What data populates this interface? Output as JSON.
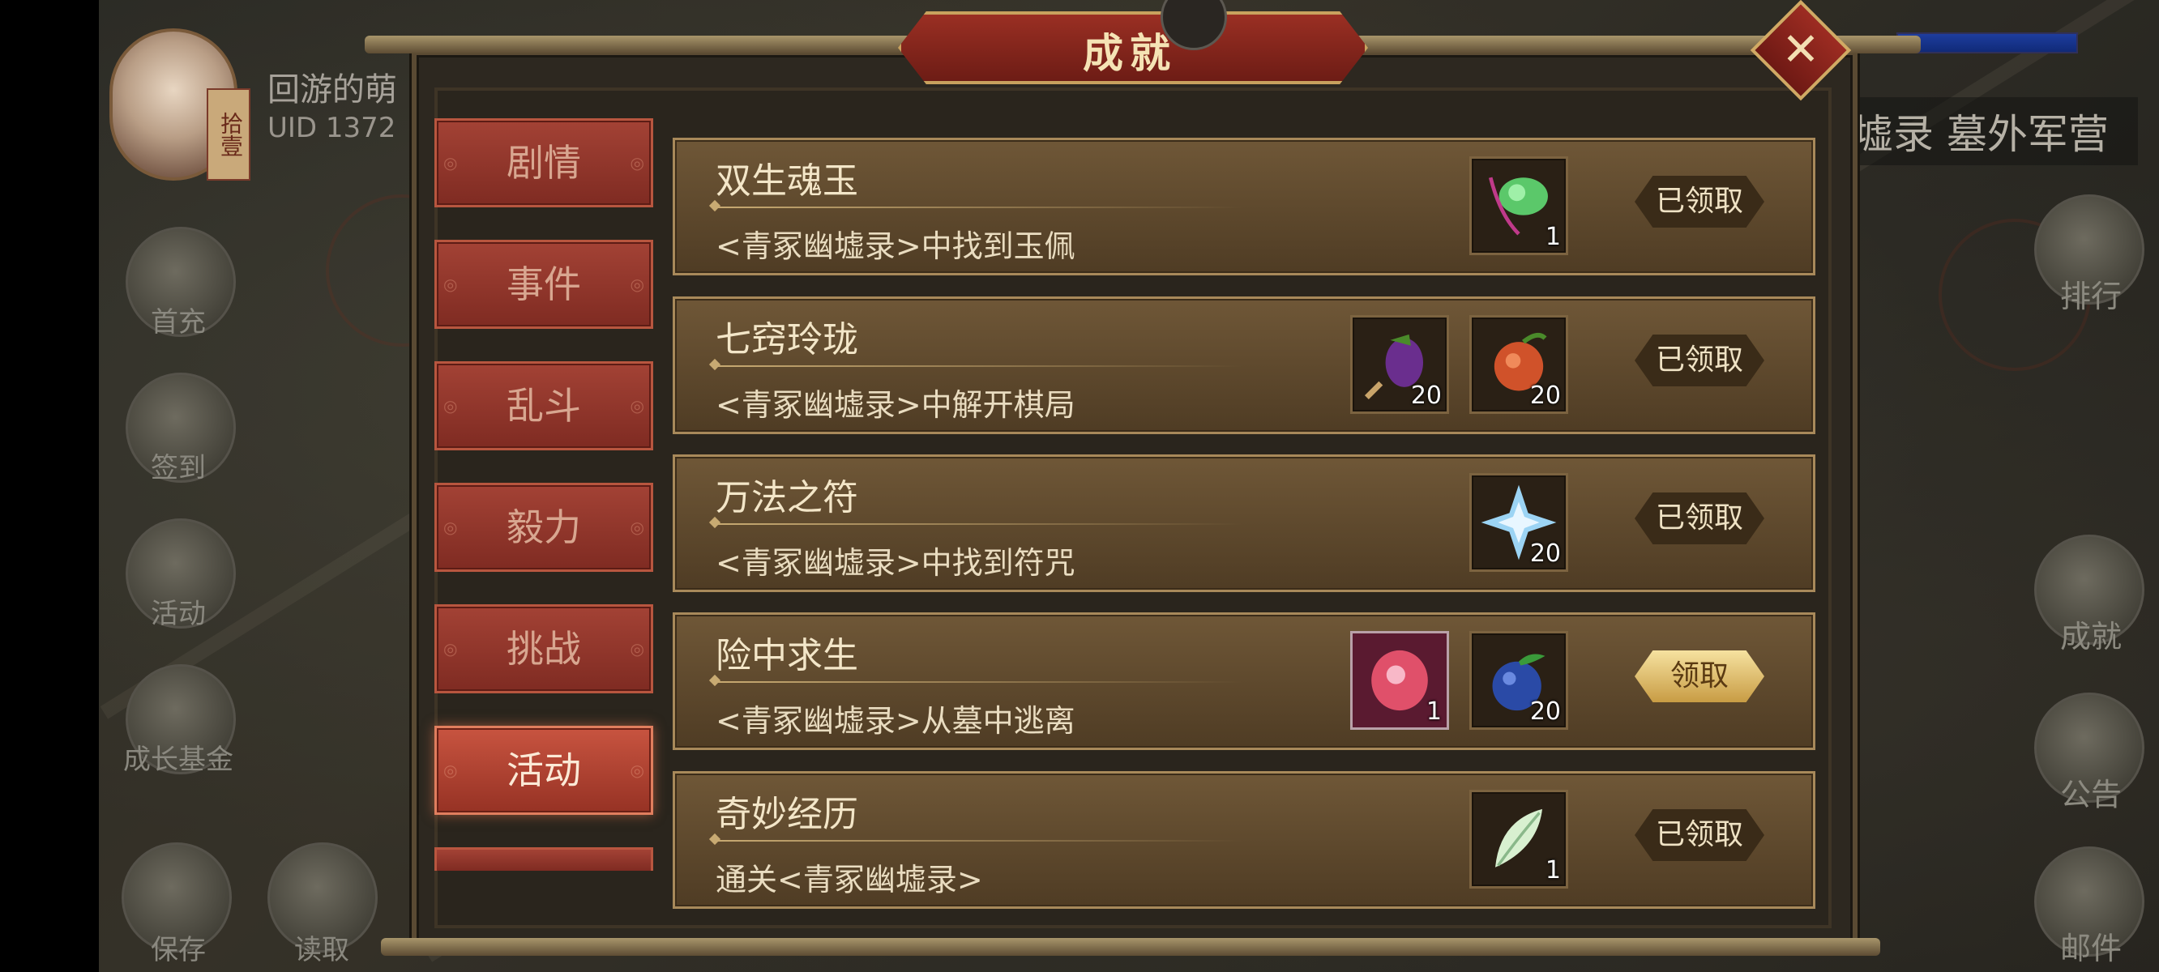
{
  "hud": {
    "player_name": "回游的萌",
    "uid_label": "UID 1372",
    "avatar_badge": "拾壹",
    "map_title": "墟录 墓外军营",
    "side_left": [
      "首充",
      "签到",
      "活动",
      "成长基金",
      "保存",
      "读取"
    ],
    "side_right": [
      "排行",
      "成就",
      "公告",
      "邮件"
    ]
  },
  "dialog": {
    "title": "成就",
    "close_glyph": "✕"
  },
  "tabs": [
    {
      "label": "剧情",
      "active": false
    },
    {
      "label": "事件",
      "active": false
    },
    {
      "label": "乱斗",
      "active": false
    },
    {
      "label": "毅力",
      "active": false
    },
    {
      "label": "挑战",
      "active": false
    },
    {
      "label": "活动",
      "active": true
    }
  ],
  "achievements": [
    {
      "title": "双生魂玉",
      "desc": "<青冢幽墟录>中找到玉佩",
      "rewards": [
        {
          "icon": "green-jade-icon",
          "qty": "1",
          "color": "#5bc86a"
        }
      ],
      "button": "已领取",
      "claimable": false
    },
    {
      "title": "七窍玲珑",
      "desc": "<青冢幽墟录>中解开棋局",
      "rewards": [
        {
          "icon": "eggplant-icon",
          "qty": "20",
          "color": "#6a2e8e"
        },
        {
          "icon": "pomegranate-icon",
          "qty": "20",
          "color": "#d0522a"
        }
      ],
      "button": "已领取",
      "claimable": false
    },
    {
      "title": "万法之符",
      "desc": "<青冢幽墟录>中找到符咒",
      "rewards": [
        {
          "icon": "ice-crystal-icon",
          "qty": "20",
          "color": "#9cd4f4"
        }
      ],
      "button": "已领取",
      "claimable": false
    },
    {
      "title": "险中求生",
      "desc": "<青冢幽墟录>从墓中逃离",
      "rewards": [
        {
          "icon": "red-gem-icon",
          "qty": "1",
          "color": "#e0506a"
        },
        {
          "icon": "blueberry-icon",
          "qty": "20",
          "color": "#2a4aa6"
        }
      ],
      "button": "领取",
      "claimable": true
    },
    {
      "title": "奇妙经历",
      "desc": "通关<青冢幽墟录>",
      "rewards": [
        {
          "icon": "white-feather-icon",
          "qty": "1",
          "color": "#d8f0d0"
        }
      ],
      "button": "已领取",
      "claimable": false
    }
  ]
}
